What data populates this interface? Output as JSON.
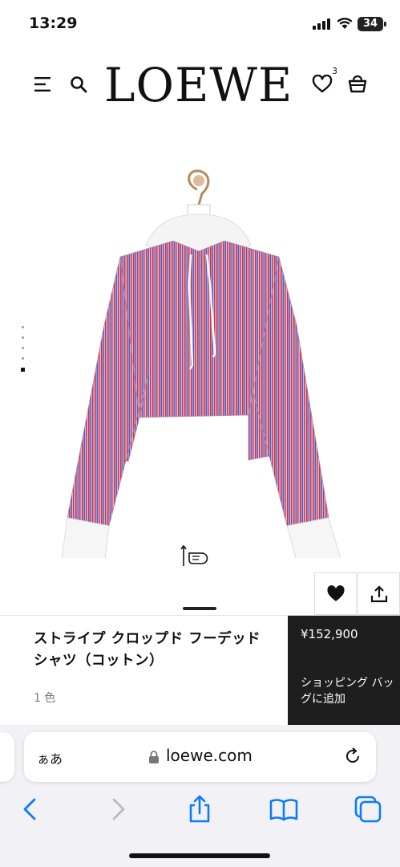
{
  "status_bar": {
    "time": "13:29",
    "battery": "34",
    "icons": [
      "cellular-signal-icon",
      "wifi-icon",
      "battery-icon"
    ]
  },
  "header": {
    "brand": "LOEWE",
    "wishlist_count": "3",
    "icons": [
      "menu-icon",
      "search-icon",
      "heart-icon",
      "shopping-bag-icon"
    ]
  },
  "gallery": {
    "image_description_icon": "striped-cropped-hooded-shirt-image",
    "dot_count": 5,
    "active_dot": 5,
    "swipe_hint_icon": "swipe-hand-icon"
  },
  "actions": {
    "favorite_icon": "heart-filled-icon",
    "share_icon": "share-icon"
  },
  "product": {
    "name": "ストライプ クロップド フーデッドシャツ（コットン）",
    "colors": "1 色",
    "price": "¥152,900",
    "add_to_bag": "ショッピング バッグに追加"
  },
  "browser": {
    "aa_label": "ぁあ",
    "url": "loewe.com",
    "toolbar_icons": [
      "back-icon",
      "forward-icon",
      "share-icon",
      "bookmarks-icon",
      "tabs-icon"
    ]
  },
  "colors": {
    "buy_panel_bg": "#1e1e1e",
    "stripe_red": "#c23a4c",
    "stripe_blue": "#4a5fc4",
    "ios_blue": "#0a7aff"
  }
}
